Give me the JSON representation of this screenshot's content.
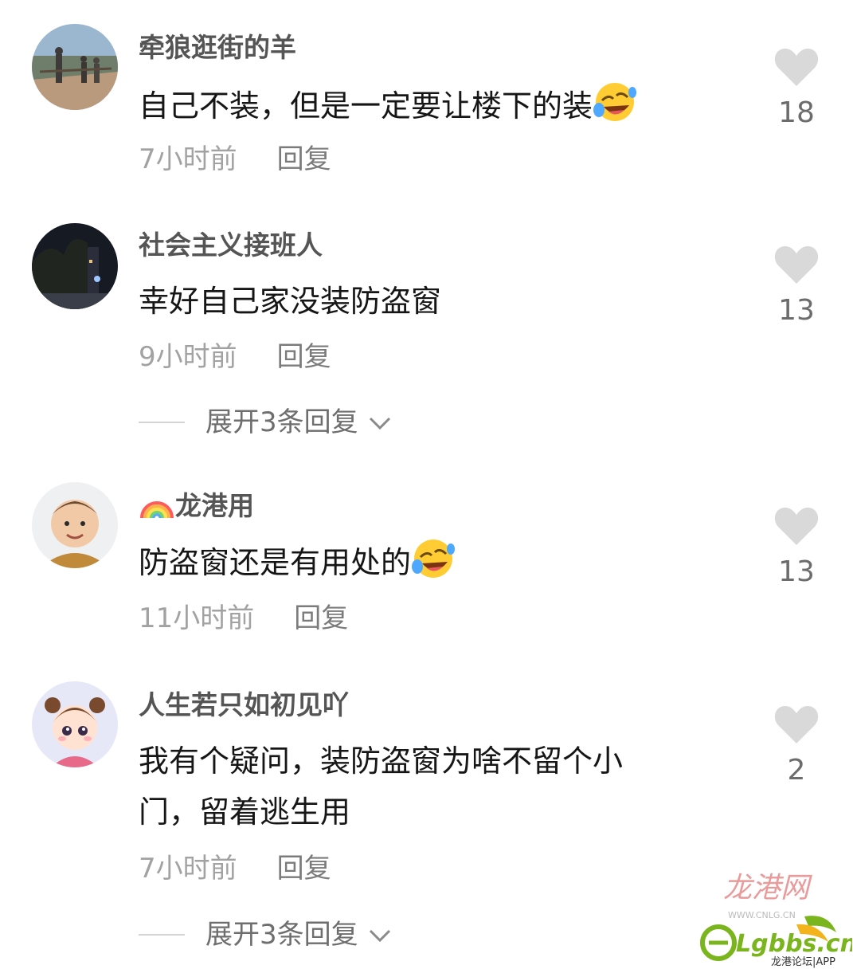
{
  "comments": [
    {
      "username": "牵狼逛街的羊",
      "text": "自己不装，但是一定要让楼下的装",
      "emoji": "rofl-icon",
      "time": "7小时前",
      "reply": "回复",
      "likes": "18"
    },
    {
      "username": "社会主义接班人",
      "text": "幸好自己家没装防盗窗",
      "time": "9小时前",
      "reply": "回复",
      "likes": "13",
      "expand": "展开3条回复"
    },
    {
      "username": "龙港用",
      "username_emoji": "rainbow-icon",
      "text": "防盗窗还是有用处的",
      "emoji": "rofl-icon",
      "time": "11小时前",
      "reply": "回复",
      "likes": "13"
    },
    {
      "username": "人生若只如初见吖",
      "text_line1": "我有个疑问，装防盗窗为啥不留个小",
      "text_line2": "门，留着逃生用",
      "time": "7小时前",
      "reply": "回复",
      "likes": "2",
      "expand": "展开3条回复"
    }
  ],
  "watermark": {
    "site_name": "龙港网",
    "site_domain": "WWW.CNLG.CN",
    "app_logo": "Lgbbs.cn",
    "app_caption": "龙港论坛|APP"
  },
  "colors": {
    "like_heart": "#d9d9d9",
    "meta_text": "#a2a2a2",
    "watermark_red": "#d9534f",
    "watermark_green": "#7ab51d"
  }
}
